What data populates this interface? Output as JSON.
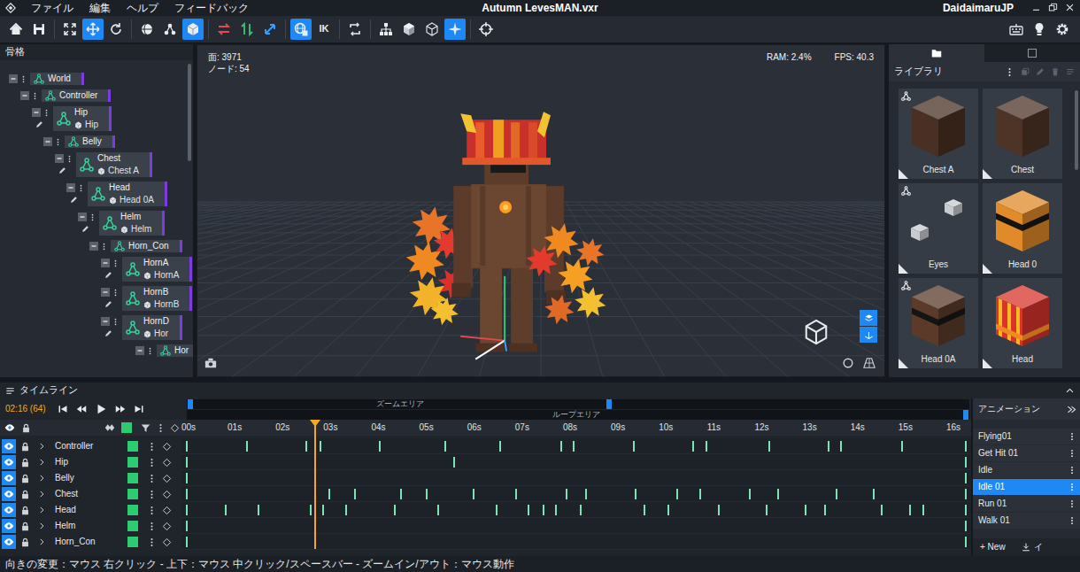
{
  "window": {
    "title": "Autumn LevesMAN.vxr",
    "user": "DaidaimaruJP",
    "menu": [
      "ファイル",
      "編集",
      "ヘルプ",
      "フィードバック"
    ]
  },
  "toolbar": {
    "groups": [
      [
        {
          "kind": "home",
          "selected": false
        },
        {
          "kind": "save",
          "selected": false
        }
      ],
      [
        {
          "kind": "fit",
          "selected": false
        },
        {
          "kind": "move",
          "selected": true
        },
        {
          "kind": "rotate",
          "selected": false
        }
      ],
      [
        {
          "kind": "sphere",
          "selected": false
        },
        {
          "kind": "nodes",
          "selected": false
        },
        {
          "kind": "cube",
          "selected": true
        }
      ],
      [
        {
          "kind": "swap",
          "selected": false
        },
        {
          "kind": "updown",
          "selected": false
        },
        {
          "kind": "scale",
          "selected": false
        }
      ],
      [
        {
          "kind": "globe",
          "selected": true
        },
        {
          "kind": "ik",
          "label": "IK",
          "selected": false
        }
      ],
      [
        {
          "kind": "refresh",
          "selected": false
        }
      ],
      [
        {
          "kind": "tree",
          "selected": false
        },
        {
          "kind": "solid",
          "selected": false
        },
        {
          "kind": "wire",
          "selected": false
        },
        {
          "kind": "sparkle",
          "selected": true
        }
      ],
      [
        {
          "kind": "target",
          "selected": false
        }
      ]
    ],
    "right": [
      {
        "kind": "keyboard",
        "selected": false
      },
      {
        "kind": "bulb",
        "selected": false
      },
      {
        "kind": "gear",
        "selected": false
      }
    ]
  },
  "skeleton": {
    "title": "骨格",
    "nodes": [
      {
        "label": "World",
        "depth": 0,
        "expanded": true
      },
      {
        "label": "Controller",
        "depth": 1,
        "expanded": true
      },
      {
        "label": "Hip",
        "mesh": "Hip",
        "depth": 2,
        "expanded": true
      },
      {
        "label": "Belly",
        "depth": 3,
        "expanded": true
      },
      {
        "label": "Chest",
        "mesh": "Chest A",
        "depth": 4,
        "expanded": true
      },
      {
        "label": "Head",
        "mesh": "Head 0A",
        "depth": 5,
        "expanded": true
      },
      {
        "label": "Helm",
        "mesh": "Helm",
        "depth": 6,
        "expanded": true
      },
      {
        "label": "Horn_Con",
        "depth": 7,
        "expanded": true
      },
      {
        "label": "HornA",
        "mesh": "HornA",
        "depth": 8,
        "expanded": true
      },
      {
        "label": "HornB",
        "mesh": "HornB",
        "depth": 8,
        "expanded": true
      },
      {
        "label": "HornD",
        "mesh": "Hor",
        "depth": 8,
        "expanded": true
      },
      {
        "label": "Hor",
        "depth": 11,
        "expanded": true
      }
    ]
  },
  "viewport": {
    "faces": "面: 3971",
    "nodes": "ノード: 54",
    "ram": "RAM: 2.4%",
    "fps": "FPS: 40.3",
    "view_toggles": [
      {
        "selected": true
      },
      {
        "selected": true
      }
    ]
  },
  "library": {
    "tabs": [
      {
        "kind": "folder",
        "selected": true
      },
      {
        "kind": "square",
        "selected": false
      }
    ],
    "title": "ライブラリ",
    "items": [
      {
        "label": "Chest A",
        "kind": "block",
        "color": "#4a3024",
        "rigged": true
      },
      {
        "label": "Chest",
        "kind": "block",
        "color": "#4e3327",
        "rigged": false
      },
      {
        "label": "Eyes",
        "kind": "eyes",
        "color": "#c8cbd0",
        "rigged": true
      },
      {
        "label": "Head 0",
        "kind": "head",
        "color": "#e08a2a",
        "rigged": false
      },
      {
        "label": "Head 0A",
        "kind": "head",
        "color": "#5b3a2a",
        "rigged": true
      },
      {
        "label": "Head",
        "kind": "helm",
        "color": "#d8342c",
        "rigged": false
      }
    ]
  },
  "timeline": {
    "title": "タイムライン",
    "time": "02:16 (64)",
    "zoom_label": "ズームエリア",
    "zoom": {
      "start": 0.005,
      "end": 0.54
    },
    "loop_label": "ループエリア",
    "loop": {
      "end": 0.995
    },
    "axis_max": 16.37,
    "ticks": [
      "00s",
      "01s",
      "02s",
      "03s",
      "04s",
      "05s",
      "06s",
      "07s",
      "08s",
      "09s",
      "10s",
      "11s",
      "12s",
      "13s",
      "14s",
      "15s",
      "16s"
    ],
    "playhead": 2.68,
    "tracks": [
      {
        "name": "Controller",
        "visible": true,
        "locked": false,
        "color": "#2ecc71",
        "keys": [
          0,
          1.26,
          2.49,
          2.79,
          4.03,
          5.39,
          6.54,
          7.82,
          8.08,
          9.33,
          10.57,
          10.85,
          12.16,
          13.4,
          13.66,
          14.93,
          16.25
        ]
      },
      {
        "name": "Hip",
        "visible": true,
        "locked": false,
        "color": "#2ecc71",
        "keys": [
          0,
          5.58,
          16.25
        ]
      },
      {
        "name": "Belly",
        "visible": true,
        "locked": false,
        "color": "#2ecc71",
        "keys": [
          0,
          16.25
        ]
      },
      {
        "name": "Chest",
        "visible": true,
        "locked": false,
        "color": "#2ecc71",
        "keys": [
          0,
          2.97,
          3.51,
          4.48,
          5.0,
          5.99,
          6.88,
          7.92,
          8.33,
          9.37,
          10.24,
          10.71,
          11.75,
          12.34,
          13.57,
          14.33,
          16.25
        ]
      },
      {
        "name": "Head",
        "visible": true,
        "locked": false,
        "color": "#2ecc71",
        "keys": [
          0,
          0.82,
          1.49,
          2.58,
          2.84,
          3.33,
          4.35,
          5.24,
          6.47,
          7.14,
          7.45,
          7.71,
          8.23,
          9.55,
          10.06,
          11.1,
          12.1,
          12.92,
          13.33,
          14.5,
          15.09,
          15.37,
          16.25
        ]
      },
      {
        "name": "Helm",
        "visible": true,
        "locked": false,
        "color": "#2ecc71",
        "keys": [
          0,
          16.25
        ]
      },
      {
        "name": "Horn_Con",
        "visible": true,
        "locked": false,
        "color": "#2ecc71",
        "keys": [
          0,
          16.25
        ]
      }
    ]
  },
  "animations": {
    "title": "アニメーション",
    "items": [
      {
        "label": "Flying01",
        "selected": false
      },
      {
        "label": "Get Hit 01",
        "selected": false
      },
      {
        "label": "Idle",
        "selected": false
      },
      {
        "label": "Idle 01",
        "selected": true
      },
      {
        "label": "Run 01",
        "selected": false
      },
      {
        "label": "Walk 01",
        "selected": false
      }
    ],
    "new": "+ New",
    "import": "イ"
  },
  "status_bar": "向きの変更：マウス 右クリック - 上下：マウス 中クリック/スペースバー - ズームイン/アウト：マウス動作"
}
